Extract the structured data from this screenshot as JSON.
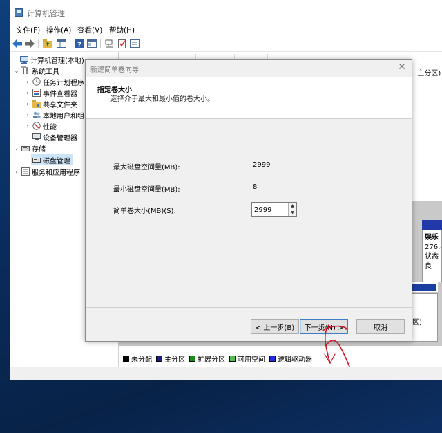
{
  "window": {
    "title": "计算机管理"
  },
  "menu": [
    "文件(F)",
    "操作(A)",
    "查看(V)",
    "帮助(H)"
  ],
  "toolbar_icons": [
    "back-icon",
    "forward-icon",
    "up-folder-icon",
    "show-tree-icon",
    "help-icon",
    "properties-icon",
    "connect-icon",
    "check-icon",
    "details-icon"
  ],
  "tree": {
    "root": "计算机管理(本地)",
    "system_tools": "系统工具",
    "task_scheduler": "任务计划程序",
    "event_viewer": "事件查看器",
    "shared_folders": "共享文件夹",
    "local_users": "本地用户和组",
    "performance": "性能",
    "device_manager": "设备管理器",
    "storage": "存储",
    "disk_management": "磁盘管理",
    "services_apps": "服务和应用程序"
  },
  "right_pane": {
    "partial_text": ", 主分区)",
    "volume_name": "娱乐",
    "volume_size": "276.4",
    "volume_status": "状态良",
    "partial_text2": "区)"
  },
  "legend": [
    {
      "label": "未分配",
      "color": "#000000"
    },
    {
      "label": "主分区",
      "color": "#1a1a8c"
    },
    {
      "label": "扩展分区",
      "color": "#1a8c1a"
    },
    {
      "label": "可用空间",
      "color": "#4cc24c"
    },
    {
      "label": "逻辑驱动器",
      "color": "#2030e0"
    }
  ],
  "dialog": {
    "title": "新建简单卷向导",
    "heading": "指定卷大小",
    "subheading": "选择介于最大和最小值的卷大小。",
    "max_label": "最大磁盘空间量(MB):",
    "max_value": "2999",
    "min_label": "最小磁盘空间量(MB):",
    "min_value": "8",
    "size_label": "简单卷大小(MB)(S):",
    "size_value": "2999",
    "back_label": "< 上一步(B)",
    "next_label": "下一步(N) >",
    "cancel_label": "取消"
  },
  "annotation_color": "#d0152a"
}
